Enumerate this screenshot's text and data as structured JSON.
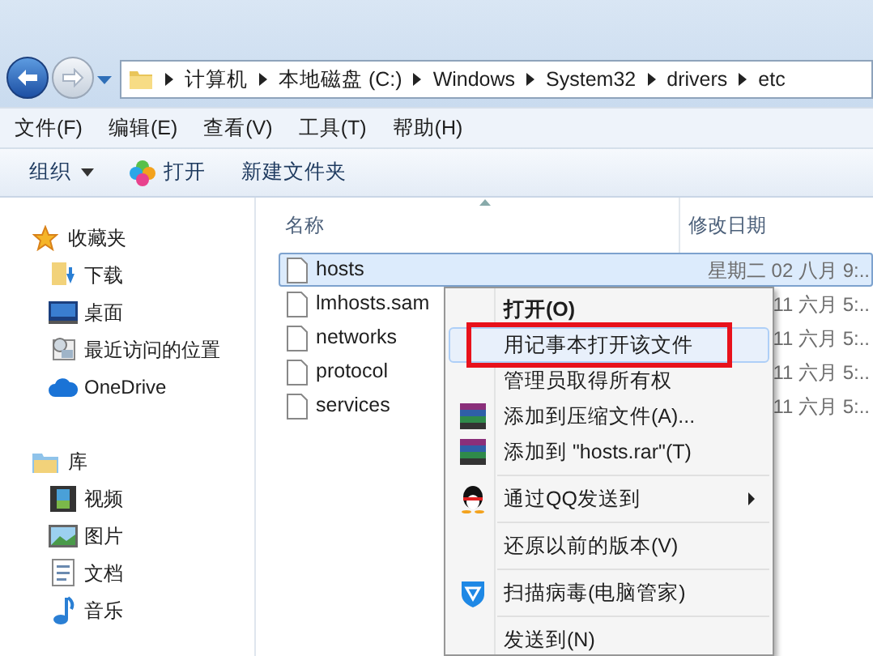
{
  "address_bar": {
    "crumbs": [
      "计算机",
      "本地磁盘 (C:)",
      "Windows",
      "System32",
      "drivers",
      "etc"
    ]
  },
  "menu_bar": [
    "文件(F)",
    "编辑(E)",
    "查看(V)",
    "工具(T)",
    "帮助(H)"
  ],
  "toolbar": {
    "organize": "组织",
    "open": "打开",
    "new_folder": "新建文件夹"
  },
  "sidebar": {
    "groups": [
      {
        "label": "收藏夹",
        "items": [
          "下载",
          "桌面",
          "最近访问的位置",
          "OneDrive"
        ]
      },
      {
        "label": "库",
        "items": [
          "视频",
          "图片",
          "文档",
          "音乐"
        ]
      }
    ]
  },
  "columns": [
    "名称",
    "修改日期"
  ],
  "files": [
    {
      "name": "hosts",
      "date": "星期二 02 八月 9:..",
      "selected": true
    },
    {
      "name": "lmhosts.sam",
      "date": "11 六月 5:..",
      "selected": false
    },
    {
      "name": "networks",
      "date": "11 六月 5:..",
      "selected": false
    },
    {
      "name": "protocol",
      "date": "11 六月 5:..",
      "selected": false
    },
    {
      "name": "services",
      "date": "11 六月 5:..",
      "selected": false
    }
  ],
  "context_menu": {
    "items": [
      {
        "kind": "default",
        "label": "打开(O)",
        "selected": false,
        "boxed": false
      },
      {
        "kind": "item",
        "label": "用记事本打开该文件",
        "selected": true,
        "boxed": true
      },
      {
        "kind": "item",
        "label": "管理员取得所有权",
        "selected": false,
        "boxed": false
      },
      {
        "kind": "item",
        "label": "添加到压缩文件(A)...",
        "selected": false,
        "boxed": false
      },
      {
        "kind": "item",
        "label": "添加到 \"hosts.rar\"(T)",
        "selected": false,
        "boxed": false
      },
      {
        "kind": "separator"
      },
      {
        "kind": "submenu",
        "label": "通过QQ发送到",
        "selected": false,
        "boxed": false
      },
      {
        "kind": "separator"
      },
      {
        "kind": "item",
        "label": "还原以前的版本(V)",
        "selected": false,
        "boxed": false
      },
      {
        "kind": "separator"
      },
      {
        "kind": "item",
        "label": "扫描病毒(电脑管家)",
        "selected": false,
        "boxed": false
      },
      {
        "kind": "separator"
      },
      {
        "kind": "item",
        "label": "发送到(N)",
        "selected": false,
        "boxed": false
      }
    ]
  }
}
